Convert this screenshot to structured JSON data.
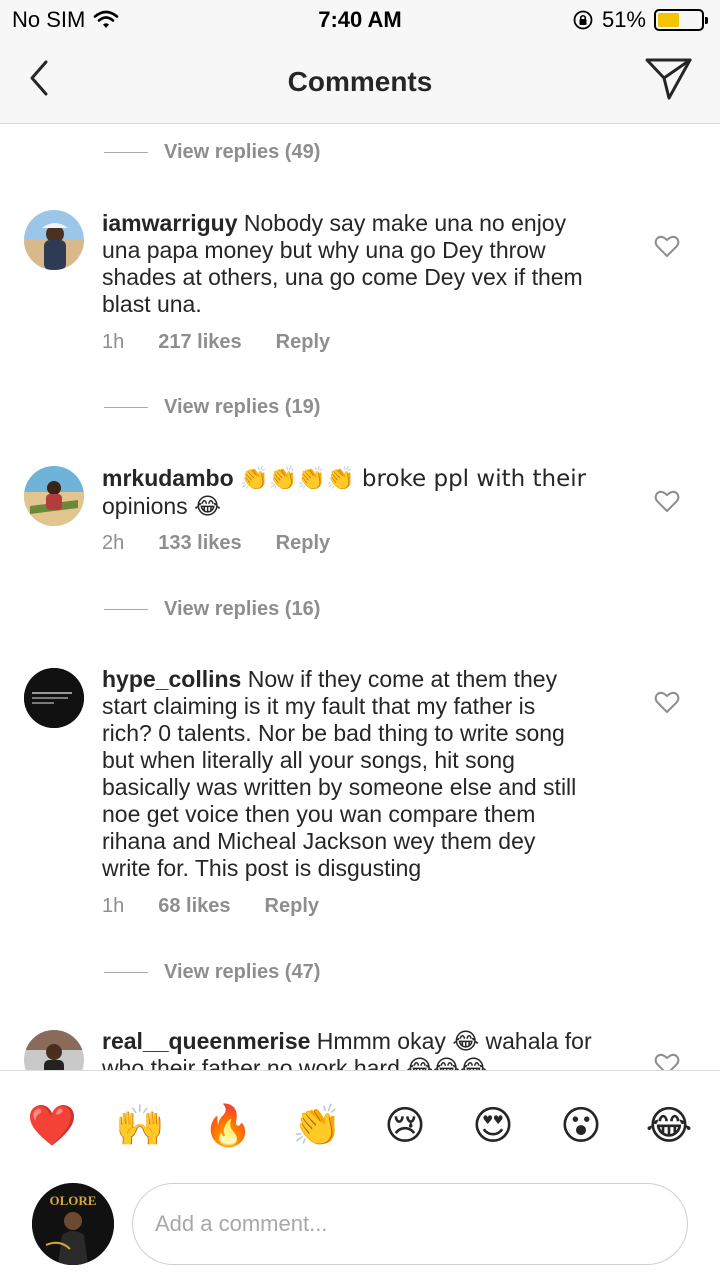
{
  "status_bar": {
    "carrier": "No SIM",
    "time": "7:40 AM",
    "battery_percent": "51%",
    "battery_level": 0.51,
    "icons": [
      "wifi-icon",
      "orientation-lock-icon",
      "battery-icon"
    ]
  },
  "nav": {
    "title": "Comments",
    "back_icon": "chevron-left-icon",
    "send_icon": "paper-plane-icon"
  },
  "replies_groups": [
    {
      "label": "View replies (49)"
    },
    {
      "label": "View replies (19)"
    },
    {
      "label": "View replies (16)"
    },
    {
      "label": "View replies (47)"
    }
  ],
  "comments": [
    {
      "username": "iamwarriguy",
      "text_lines": [
        "Nobody say make una no enjoy",
        "una papa money but why una go Dey throw",
        "shades at others, una go come Dey vex if them",
        "blast una."
      ],
      "time": "1h",
      "likes": "217 likes",
      "reply": "Reply"
    },
    {
      "username": "mrkudambo",
      "text_lines": [
        "👏👏👏👏 broke ppl with their",
        "opinions 😂"
      ],
      "time": "2h",
      "likes": "133 likes",
      "reply": "Reply"
    },
    {
      "username": "hype_collins",
      "text_lines": [
        "Now if they come at them they",
        "start claiming is it my fault that my father is",
        "rich? 0 talents. Nor be bad thing to write song",
        "but when literally all your songs, hit song",
        "basically was written by someone else and still",
        "noe get voice then you wan compare them",
        "rihana and Micheal Jackson wey them dey",
        "write for. This post is disgusting"
      ],
      "time": "1h",
      "likes": "68 likes",
      "reply": "Reply"
    },
    {
      "username": "real__queenmerise",
      "text_lines": [
        "Hmmm okay 😂 wahala for",
        "who their father no work hard 😂😂😂"
      ]
    }
  ],
  "reactions": [
    "❤️",
    "🙌",
    "🔥",
    "👏",
    "😢",
    "😍",
    "😮",
    "😂"
  ],
  "composer": {
    "placeholder": "Add a comment...",
    "avatar_logo_text": "OLORE"
  },
  "colors": {
    "text": "#262626",
    "secondary": "#8e8e8e",
    "battery": "#f5c400",
    "reaction_heart": "#e0245e"
  }
}
